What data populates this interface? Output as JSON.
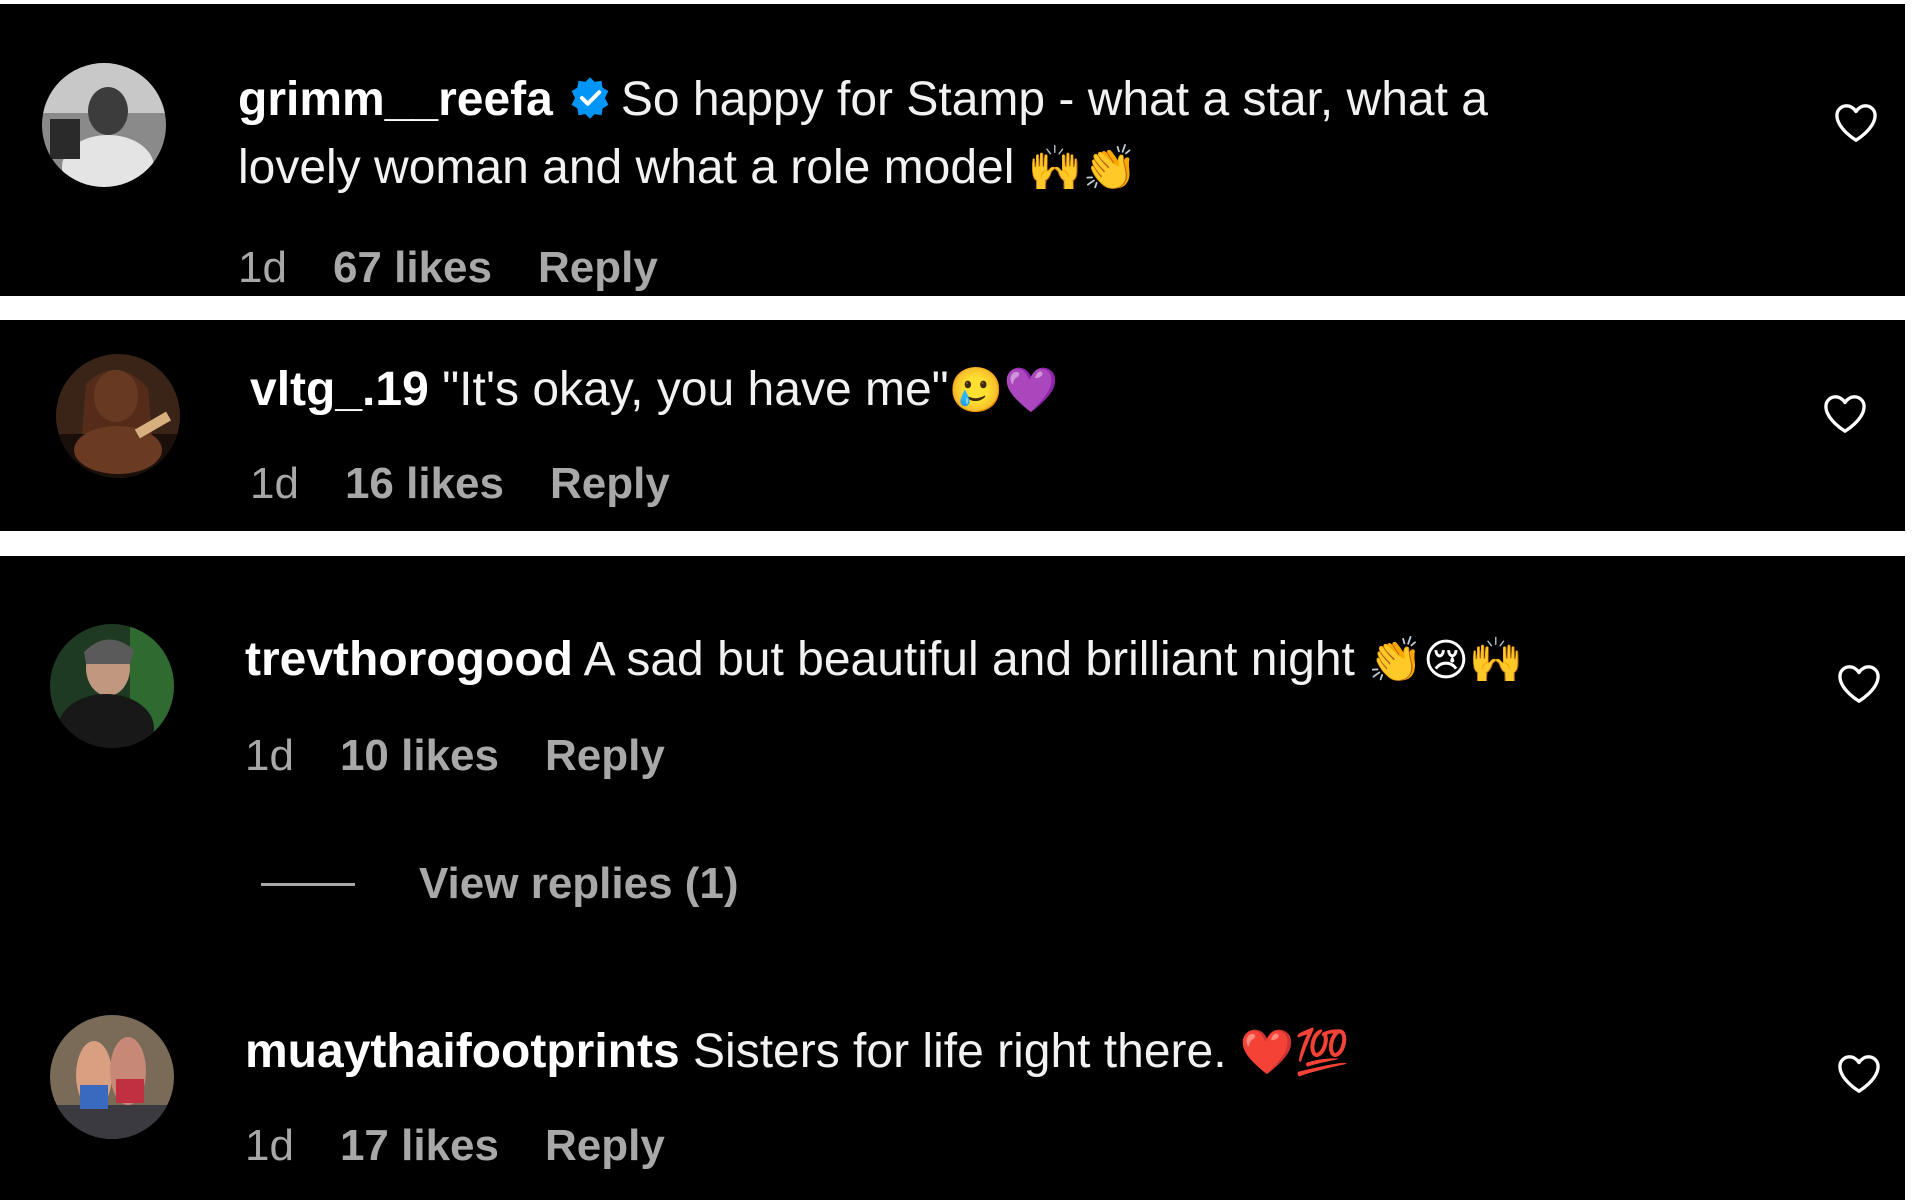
{
  "comments": [
    {
      "username": "grimm__reefa",
      "verified": true,
      "text_line1": "So happy for Stamp - what a star, what a",
      "text_line2": "lovely woman and what a role model",
      "emoji": "🙌👏",
      "time": "1d",
      "likes": "67 likes",
      "reply": "Reply"
    },
    {
      "username": "vltg_.19",
      "verified": false,
      "text": "\"It's okay, you have me\"",
      "emoji": "🥲💜",
      "time": "1d",
      "likes": "16 likes",
      "reply": "Reply"
    },
    {
      "username": "trevthorogood",
      "verified": false,
      "text": "A sad but beautiful and brilliant night",
      "emoji": "👏😢🙌",
      "time": "1d",
      "likes": "10 likes",
      "reply": "Reply",
      "view_replies": "View replies (1)"
    },
    {
      "username": "muaythaifootprints",
      "verified": false,
      "text": "Sisters for life right there.",
      "emoji": "❤️💯",
      "time": "1d",
      "likes": "17 likes",
      "reply": "Reply"
    }
  ],
  "icons": {
    "like": "heart-outline-icon",
    "verified": "verified-badge-icon"
  },
  "colors": {
    "background": "#000000",
    "text": "#ffffff",
    "meta": "#a8a8a8",
    "verified": "#0095f6"
  }
}
